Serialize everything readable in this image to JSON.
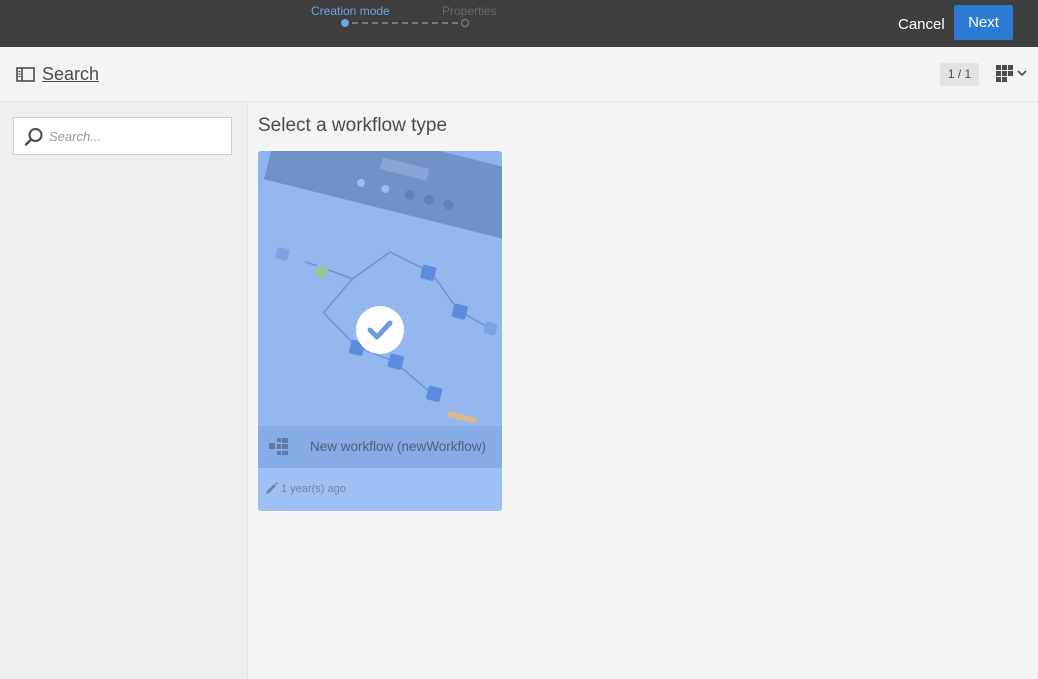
{
  "wizard": {
    "steps": [
      {
        "label": "Creation mode",
        "state": "active"
      },
      {
        "label": "Properties",
        "state": "inactive"
      }
    ],
    "cancel_label": "Cancel",
    "next_label": "Next"
  },
  "header": {
    "search_link": "Search",
    "pager": "1 / 1",
    "view_icon": "grid-view-icon"
  },
  "sidebar": {
    "search_placeholder": "Search...",
    "search_value": ""
  },
  "main": {
    "title": "Select a workflow type",
    "cards": [
      {
        "name": "New workflow (newWorkflow)",
        "modified": "1 year(s) ago",
        "selected": true,
        "icon": "workflow-icon"
      }
    ]
  },
  "colors": {
    "topbar": "#3e3e3e",
    "accent": "#2d7ad3",
    "active_step": "#6fa3e8",
    "card_selected": "#9ec1f5"
  }
}
